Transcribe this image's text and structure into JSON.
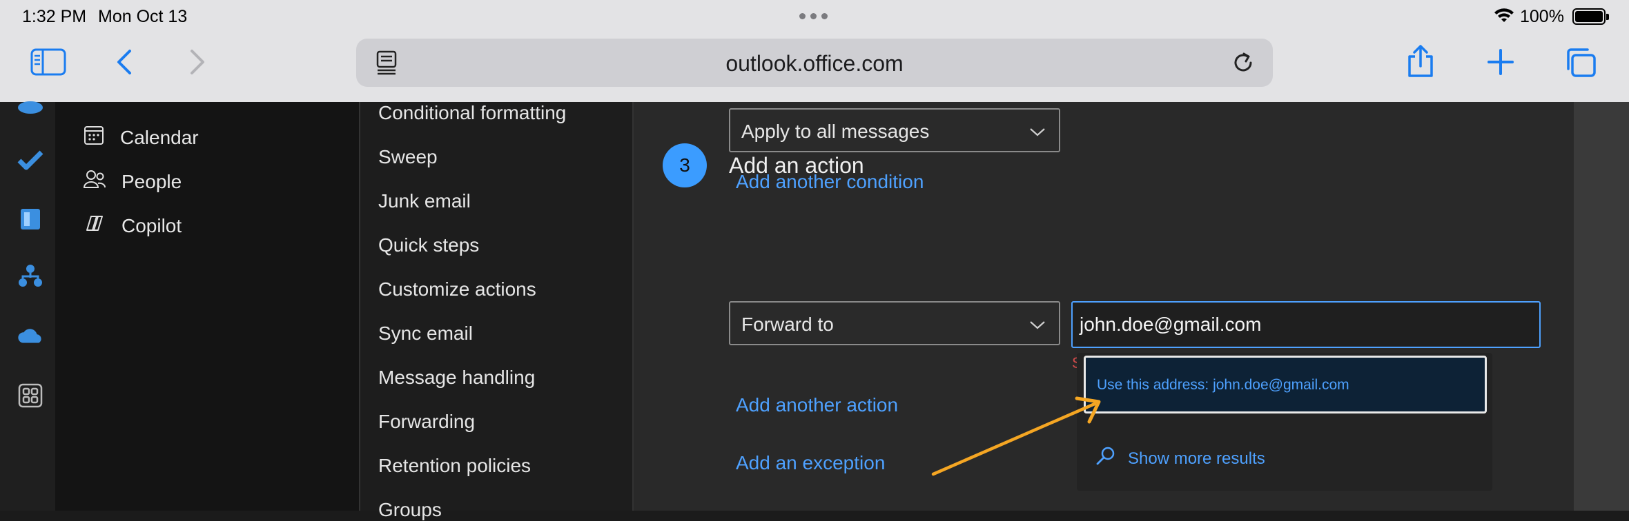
{
  "status_bar": {
    "time": "1:32 PM",
    "date": "Mon Oct 13",
    "battery": "100%"
  },
  "browser": {
    "url": "outlook.office.com"
  },
  "rail": {
    "icons": [
      "cloud-icon",
      "todo-check-icon",
      "notebook-icon",
      "org-chart-icon",
      "onedrive-icon",
      "apps-grid-icon"
    ]
  },
  "folders": {
    "items": [
      {
        "label": "Calendar",
        "icon": "calendar-icon"
      },
      {
        "label": "People",
        "icon": "people-icon"
      },
      {
        "label": "Copilot",
        "icon": "copilot-icon"
      }
    ]
  },
  "settings_nav": {
    "items": [
      "Conditional formatting",
      "Sweep",
      "Junk email",
      "Quick steps",
      "Customize actions",
      "Sync email",
      "Message handling",
      "Forwarding",
      "Retention policies",
      "Groups"
    ]
  },
  "rule": {
    "condition_select": "Apply to all messages",
    "add_condition": "Add another condition",
    "step_number": "3",
    "step_title": "Add an action",
    "action_select": "Forward to",
    "email_value": "john.doe@gmail.com",
    "error_char": "S",
    "add_action": "Add another action",
    "add_exception": "Add an exception"
  },
  "suggestions": {
    "use_address": "Use this address: john.doe@gmail.com",
    "show_more": "Show more results"
  },
  "colors": {
    "accent": "#4ea1ff",
    "annotation_arrow": "#f5a623"
  }
}
